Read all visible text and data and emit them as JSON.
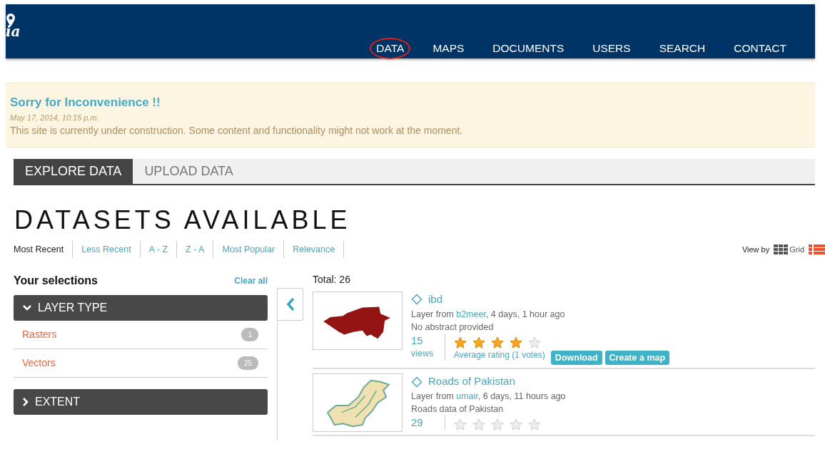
{
  "header": {
    "logo_text": "ia",
    "nav": [
      {
        "label": "DATA",
        "selected": true
      },
      {
        "label": "MAPS",
        "selected": false
      },
      {
        "label": "DOCUMENTS",
        "selected": false
      },
      {
        "label": "USERS",
        "selected": false
      },
      {
        "label": "SEARCH",
        "selected": false
      },
      {
        "label": "CONTACT",
        "selected": false
      }
    ]
  },
  "notice": {
    "title": "Sorry for Inconvenience !!",
    "date": "May 17, 2014, 10:15 p.m.",
    "message": "This site is currently under construction. Some content and functionality might not work at the moment."
  },
  "tabs": [
    {
      "label": "EXPLORE DATA",
      "selected": true
    },
    {
      "label": "UPLOAD DATA",
      "selected": false
    }
  ],
  "heading": "DATASETS AVAILABLE",
  "sort_options": [
    {
      "label": "Most Recent",
      "selected": true
    },
    {
      "label": "Less Recent",
      "selected": false
    },
    {
      "label": "A - Z",
      "selected": false
    },
    {
      "label": "Z - A",
      "selected": false
    },
    {
      "label": "Most Popular",
      "selected": false
    },
    {
      "label": "Relevance",
      "selected": false
    }
  ],
  "view_by": {
    "label": "View by",
    "options": [
      {
        "kind": "grid",
        "label": "Grid",
        "selected": false
      },
      {
        "kind": "list",
        "selected": true
      }
    ]
  },
  "selections": {
    "title": "Your selections",
    "clear": "Clear all",
    "facets": [
      {
        "title": "LAYER TYPE",
        "expanded": true,
        "items": [
          {
            "label": "Rasters",
            "count": "1"
          },
          {
            "label": "Vectors",
            "count": "25"
          }
        ]
      },
      {
        "title": "EXTENT",
        "expanded": false
      }
    ]
  },
  "total": "Total: 26",
  "results": [
    {
      "title": "ibd",
      "owner_prefix": "Layer from",
      "owner": "b2meer",
      "age": ", 4 days, 1 hour ago",
      "abstract": "No abstract provided",
      "views": "15",
      "views_label": "views",
      "stars": 4,
      "rating_text": "Average rating (1 votes)",
      "buttons": [
        "Download",
        "Create a map"
      ]
    },
    {
      "title": "Roads of Pakistan",
      "owner_prefix": "Layer from",
      "owner": "umair",
      "age": ", 6 days, 11 hours ago",
      "abstract": "Roads data of Pakistan",
      "views": "29",
      "stars": 0
    }
  ]
}
